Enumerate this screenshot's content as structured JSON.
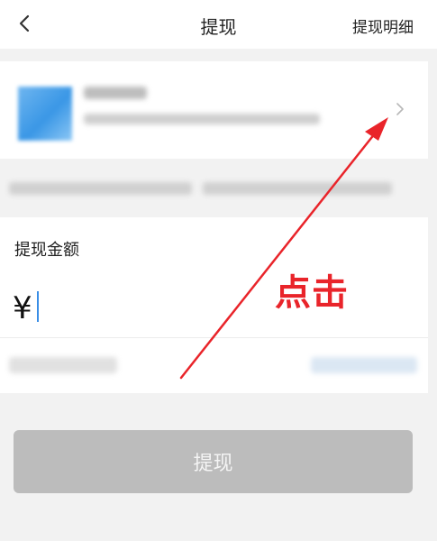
{
  "header": {
    "title": "提现",
    "detail_link": "提现明细"
  },
  "amount": {
    "label": "提现金额",
    "currency_symbol": "¥"
  },
  "withdraw_button_label": "提现",
  "annotation": {
    "text": "点击",
    "color": "#e9242a"
  },
  "colors": {
    "button_disabled": "#bcbcbc",
    "caret": "#3a8ee6"
  }
}
